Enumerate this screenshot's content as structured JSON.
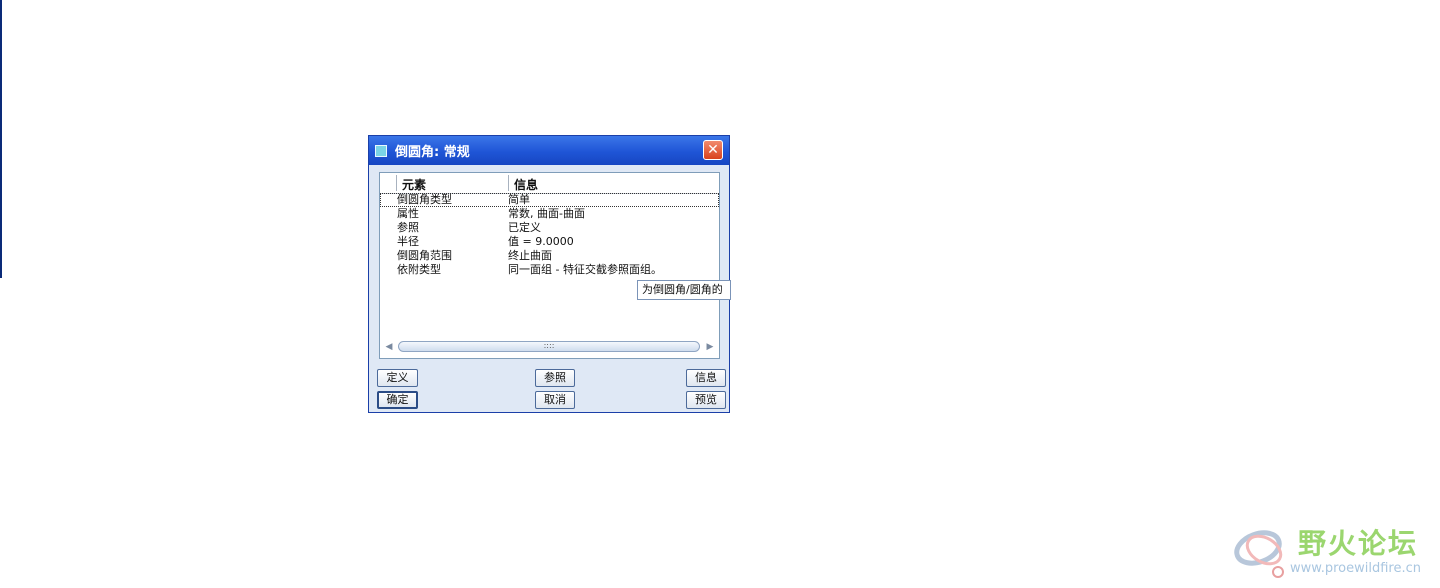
{
  "dialog": {
    "title": "倒圆角: 常规",
    "columns": {
      "element": "元素",
      "info": "信息"
    },
    "rows": [
      {
        "element": "倒圆角类型",
        "info": "简单"
      },
      {
        "element": "属性",
        "info": "常数, 曲面-曲面"
      },
      {
        "element": "参照",
        "info": "已定义"
      },
      {
        "element": "半径",
        "info": "值 = 9.0000"
      },
      {
        "element": "倒圆角范围",
        "info": "终止曲面"
      },
      {
        "element": "依附类型",
        "info": "同一面组 - 特征交截参照面组。"
      }
    ],
    "tooltip": "为倒圆角/圆角的",
    "scroll_thumb": "::::",
    "buttons": {
      "define": "定义",
      "refs": "参照",
      "info": "信息",
      "ok": "确定",
      "cancel": "取消",
      "preview": "预览"
    }
  },
  "watermark": {
    "name": "野火论坛",
    "url": "www.proewildfire.cn"
  }
}
